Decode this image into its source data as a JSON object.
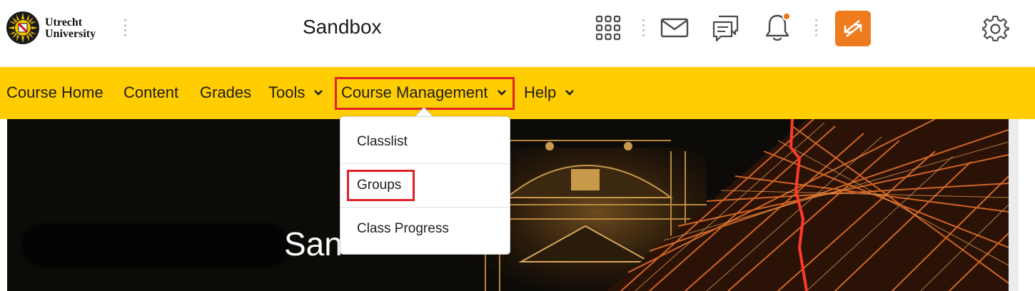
{
  "header": {
    "logo": {
      "line1": "Utrecht",
      "line2": "University"
    },
    "course_title": "Sandbox",
    "icons": [
      "apps-grid-icon",
      "mail-icon",
      "chat-icon",
      "bell-icon",
      "role-switch-icon",
      "gear-icon"
    ]
  },
  "navbar": {
    "items": [
      {
        "label": "Course Home",
        "has_dropdown": false
      },
      {
        "label": "Content",
        "has_dropdown": false
      },
      {
        "label": "Grades",
        "has_dropdown": false
      },
      {
        "label": "Tools",
        "has_dropdown": true
      },
      {
        "label": "Course Management",
        "has_dropdown": true,
        "highlighted": true
      },
      {
        "label": "Help",
        "has_dropdown": true
      }
    ]
  },
  "dropdown": {
    "items": [
      {
        "label": "Classlist"
      },
      {
        "label": "Groups",
        "highlighted": true
      },
      {
        "label": "Class Progress"
      }
    ]
  },
  "banner": {
    "title_visible": "San"
  },
  "colors": {
    "navbar": "#ffcd00",
    "accent_orange": "#ee7b1e",
    "highlight_red": "#e0202a",
    "notification_dot": "#e87511"
  }
}
